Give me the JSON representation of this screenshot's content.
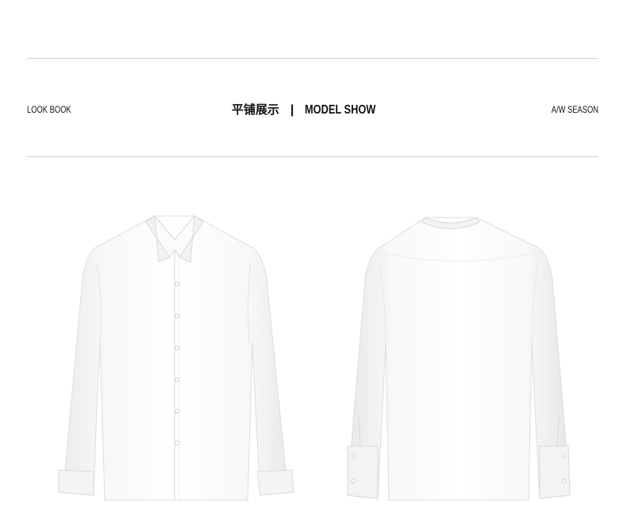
{
  "header": {
    "left_label": "LOOK BOOK",
    "center_cn": "平铺展示",
    "separator": "|",
    "center_en": "MODEL SHOW",
    "right_label": "A/W SEASON"
  },
  "products": [
    {
      "view": "front",
      "icon": "shirt-front-image"
    },
    {
      "view": "back",
      "icon": "shirt-back-image"
    }
  ],
  "colors": {
    "rule": "#cfcfcf",
    "text": "#111111",
    "shirt": "#ffffff"
  }
}
